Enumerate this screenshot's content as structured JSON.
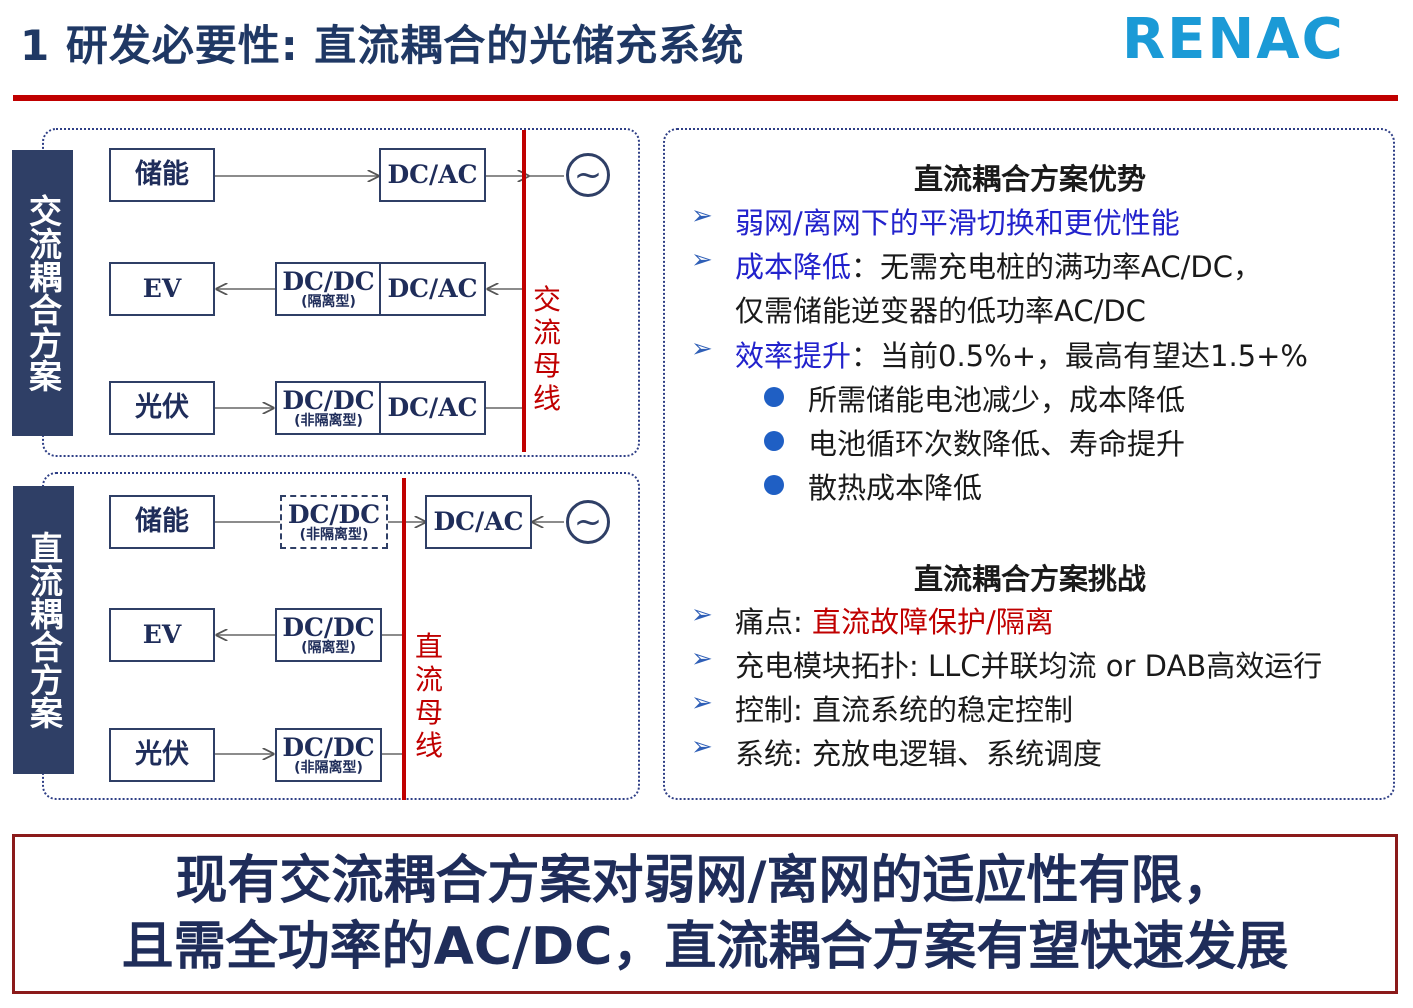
{
  "header": {
    "title": "1 研发必要性: 直流耦合的光储充系统",
    "logo_text": "RENAC"
  },
  "ac_scheme": {
    "label": "交流耦合方案",
    "bus_label": "交流母线",
    "blocks": {
      "storage": "储能",
      "ev": "EV",
      "pv": "光伏",
      "dcac1": "DC/AC",
      "dcdc_iso": "DC/DC",
      "dcdc_iso_sub": "(隔离型)",
      "dcac2": "DC/AC",
      "dcdc_noniso": "DC/DC",
      "dcdc_noniso_sub": "(非隔离型)",
      "dcac3": "DC/AC"
    },
    "grid_symbol": "~"
  },
  "dc_scheme": {
    "label": "直流耦合方案",
    "bus_label": "直流母线",
    "blocks": {
      "storage": "储能",
      "ev": "EV",
      "pv": "光伏",
      "dcdc_storage": "DC/DC",
      "dcdc_storage_sub": "(非隔离型)",
      "dcac": "DC/AC",
      "dcdc_ev": "DC/DC",
      "dcdc_ev_sub": "(隔离型)",
      "dcdc_pv": "DC/DC",
      "dcdc_pv_sub": "(非隔离型)"
    },
    "grid_symbol": "~"
  },
  "advantages": {
    "title": "直流耦合方案优势",
    "items": [
      {
        "label": "弱网/离网下的平滑切换和更优性能",
        "text": ""
      },
      {
        "label": "成本降低",
        "text": "：无需充电桩的满功率AC/DC，",
        "cont": "仅需储能逆变器的低功率AC/DC"
      },
      {
        "label": "效率提升",
        "text": "：当前0.5%+，最高有望达1.5+%"
      }
    ],
    "sub_items": [
      "所需储能电池减少，成本降低",
      "电池循环次数降低、寿命提升",
      "散热成本降低"
    ]
  },
  "challenges": {
    "title": "直流耦合方案挑战",
    "items": [
      {
        "prefix": "痛点: ",
        "highlight": "直流故障保护/隔离",
        "text": ""
      },
      {
        "prefix": "充电模块拓扑: LLC并联均流 or DAB高效运行",
        "highlight": "",
        "text": ""
      },
      {
        "prefix": "控制: 直流系统的稳定控制",
        "highlight": "",
        "text": ""
      },
      {
        "prefix": "系统: 充放电逻辑、系统调度",
        "highlight": "",
        "text": ""
      }
    ]
  },
  "conclusion": {
    "line1": "现有交流耦合方案对弱网/离网的适应性有限，",
    "line2": "且需全功率的AC/DC，直流耦合方案有望快速发展"
  },
  "colors": {
    "navy": "#1f2d5a",
    "red": "#c00000",
    "logo_blue": "#1b9ad6",
    "highlight_blue": "#2222cc"
  }
}
